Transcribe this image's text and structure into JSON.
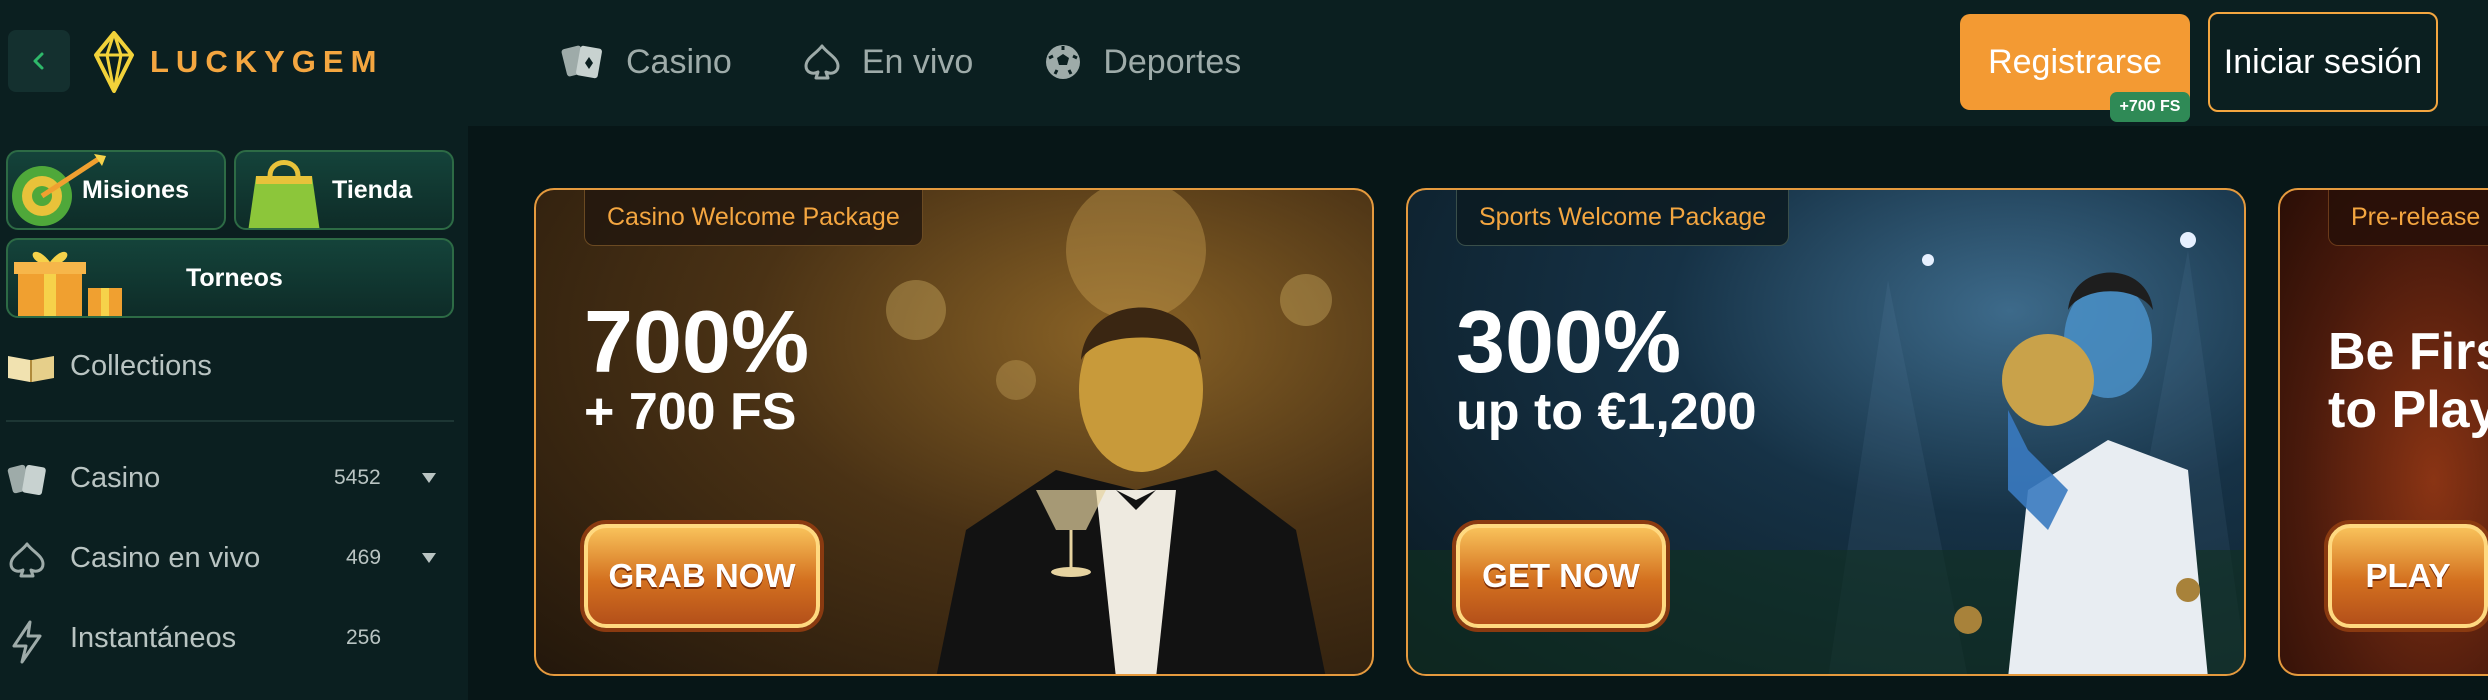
{
  "header": {
    "brand": "LUCKYGEM",
    "nav": [
      {
        "label": "Casino",
        "icon": "cards-icon"
      },
      {
        "label": "En vivo",
        "icon": "spade-icon"
      },
      {
        "label": "Deportes",
        "icon": "soccer-ball-icon"
      }
    ],
    "register_label": "Registrarse",
    "register_badge": "+700 FS",
    "login_label": "Iniciar sesión"
  },
  "sidebar": {
    "promos": [
      {
        "label": "Misiones"
      },
      {
        "label": "Tienda"
      },
      {
        "label": "Torneos"
      }
    ],
    "collections_label": "Collections",
    "items": [
      {
        "label": "Casino",
        "count": "5452"
      },
      {
        "label": "Casino en vivo",
        "count": "469"
      },
      {
        "label": "Instantáneos",
        "count": "256"
      }
    ]
  },
  "banners": [
    {
      "tag": "Casino Welcome Package",
      "headline": "700%",
      "subline": "+ 700 FS",
      "cta": "GRAB NOW"
    },
    {
      "tag": "Sports Welcome Package",
      "headline": "300%",
      "subline": "up to €1,200",
      "cta": "GET NOW"
    },
    {
      "tag": "Pre-release",
      "line1": "Be Firs",
      "line2": "to Play",
      "cta": "PLAY"
    }
  ],
  "colors": {
    "accent": "#f39a33",
    "badge_green": "#2f8a56",
    "background": "#071617",
    "panel": "#0b1f20"
  }
}
